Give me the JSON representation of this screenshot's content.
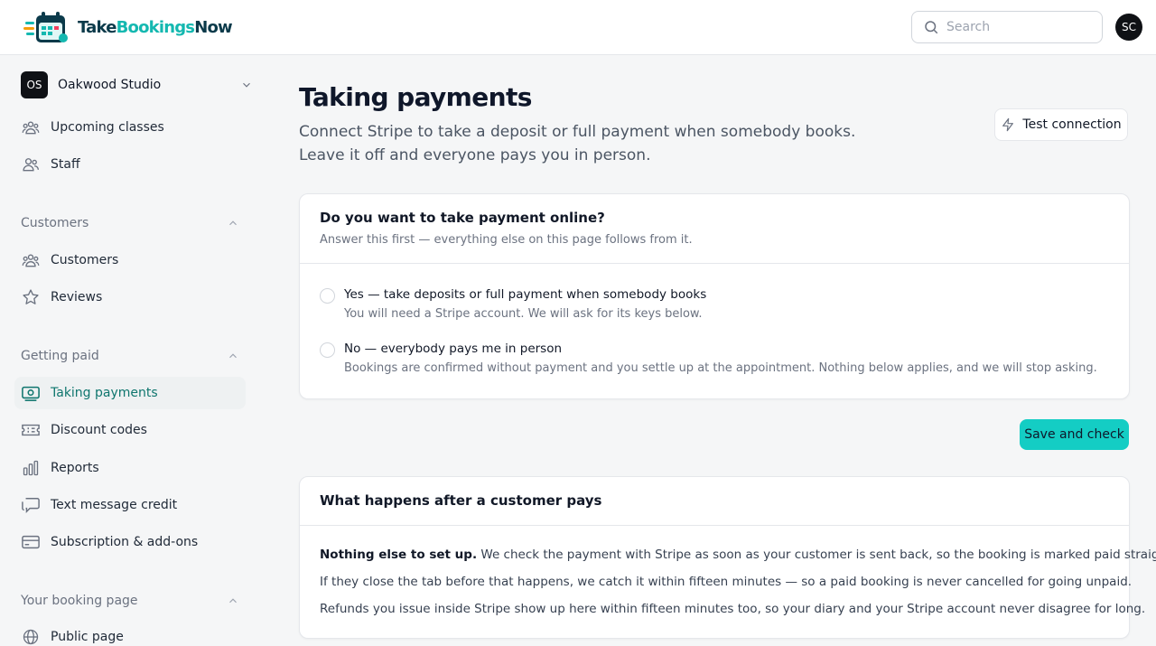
{
  "brand": {
    "logo_text_1": "Take",
    "logo_text_2": "Bookings",
    "logo_text_3": "Now",
    "accent": "#14b8b0",
    "dark": "#0b3a4a"
  },
  "header": {
    "search_placeholder": "Search",
    "avatar_initials": "SC"
  },
  "sidebar": {
    "org": {
      "initials": "OS",
      "name": "Oakwood Studio"
    },
    "top_items": [
      {
        "label": "Upcoming classes",
        "icon": "users-icon"
      },
      {
        "label": "Staff",
        "icon": "staff-icon"
      }
    ],
    "sections": [
      {
        "title": "Customers",
        "items": [
          {
            "label": "Customers",
            "icon": "users-icon"
          },
          {
            "label": "Reviews",
            "icon": "star-icon"
          }
        ]
      },
      {
        "title": "Getting paid",
        "items": [
          {
            "label": "Taking payments",
            "icon": "payments-icon",
            "active": true
          },
          {
            "label": "Discount codes",
            "icon": "ticket-icon"
          },
          {
            "label": "Reports",
            "icon": "bar-chart-icon"
          },
          {
            "label": "Text message credit",
            "icon": "message-icon"
          },
          {
            "label": "Subscription & add-ons",
            "icon": "credit-card-icon"
          }
        ]
      },
      {
        "title": "Your booking page",
        "items": [
          {
            "label": "Public page",
            "icon": "globe-icon"
          }
        ]
      }
    ]
  },
  "main": {
    "title": "Taking payments",
    "subtitle": "Connect Stripe to take a deposit or full payment when somebody books. Leave it off and everyone pays you in person.",
    "test_button": "Test connection",
    "question_card": {
      "title": "Do you want to take payment online?",
      "hint": "Answer this first — everything else on this page follows from it.",
      "options": [
        {
          "title": "Yes — take deposits or full payment when somebody books",
          "description": "You will need a Stripe account. We will ask for its keys below."
        },
        {
          "title": "No — everybody pays me in person",
          "description": "Bookings are confirmed without payment and you settle up at the appointment. Nothing below applies, and we will stop asking."
        }
      ]
    },
    "save_button": "Save and check",
    "after_card": {
      "title": "What happens after a customer pays",
      "lead_bold": "Nothing else to set up.",
      "lead_rest": " We check the payment with Stripe as soon as your customer is sent back, so the booking is marked paid straight away.",
      "line2": "If they close the tab before that happens, we catch it within fifteen minutes — so a paid booking is never cancelled for going unpaid.",
      "line3": "Refunds you issue inside Stripe show up here within fifteen minutes too, so your diary and your Stripe account never disagree for long."
    }
  }
}
